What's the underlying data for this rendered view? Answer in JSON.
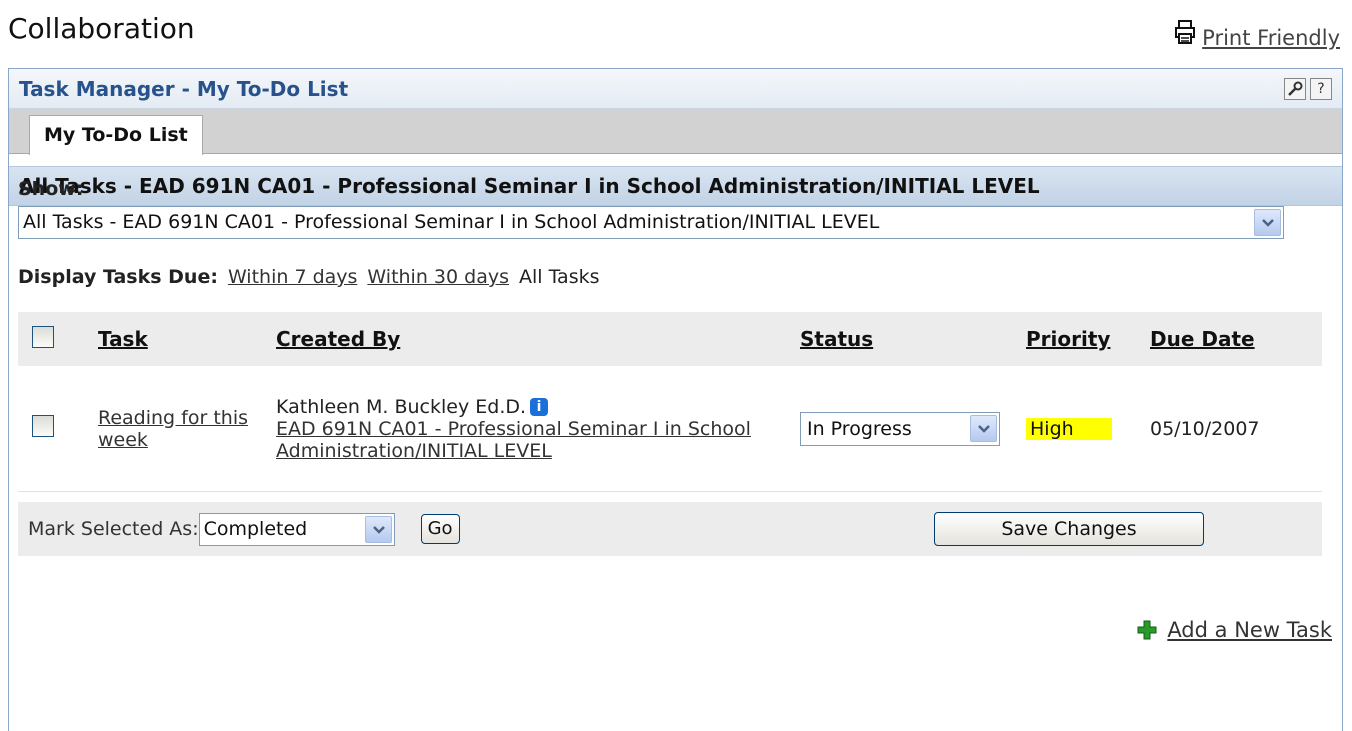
{
  "page": {
    "title": "Collaboration",
    "print_friendly": "Print Friendly"
  },
  "portlet": {
    "title": "Task Manager - My To-Do List",
    "tools": {
      "config_icon": "wrench-icon",
      "help_label": "?"
    },
    "tab": "My To-Do List",
    "section_title": "All Tasks - EAD 691N CA01 - Professional Seminar I in School Administration/INITIAL LEVEL"
  },
  "filters": {
    "show_label": "Show:",
    "show_value": "All Tasks - EAD 691N CA01 - Professional Seminar I in School Administration/INITIAL LEVEL",
    "due_label": "Display Tasks Due:",
    "due_7": "Within 7 days",
    "due_30": "Within 30 days",
    "due_all": "All Tasks"
  },
  "table": {
    "headers": {
      "task": "Task",
      "created_by": "Created By",
      "status": "Status",
      "priority": "Priority",
      "due_date": "Due Date"
    },
    "rows": [
      {
        "task": "Reading for this week",
        "created_name": "Kathleen M. Buckley Ed.D.",
        "created_course": "EAD 691N CA01 - Professional Seminar I in School Administration/INITIAL LEVEL",
        "status": "In Progress",
        "priority": "High",
        "due_date": "05/10/2007"
      }
    ]
  },
  "actions": {
    "mark_label": "Mark Selected As:",
    "mark_value": "Completed",
    "go": "Go",
    "save": "Save Changes"
  },
  "add_task": "Add a New Task",
  "colors": {
    "accent": "#27528c",
    "priority_high": "#ffff00"
  }
}
